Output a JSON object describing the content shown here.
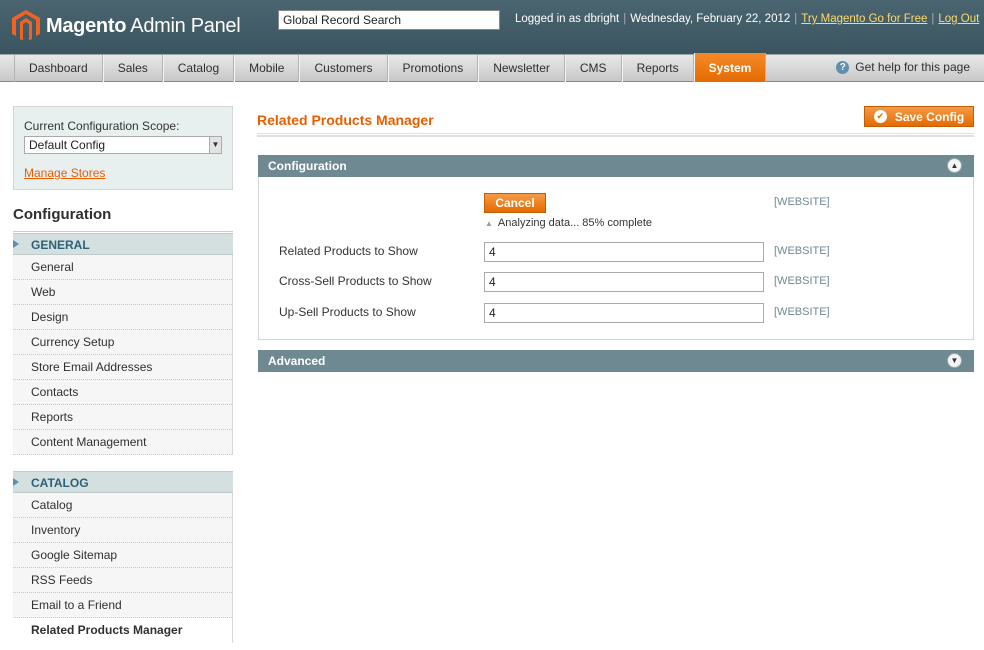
{
  "header": {
    "logo_brand": "Magento",
    "logo_suffix": "Admin Panel",
    "search_value": "Global Record Search",
    "logged_in": "Logged in as dbright",
    "date": "Wednesday, February 22, 2012",
    "try_link": "Try Magento Go for Free",
    "logout": "Log Out",
    "brand_color": "#eb5e00"
  },
  "nav": {
    "items": [
      "Dashboard",
      "Sales",
      "Catalog",
      "Mobile",
      "Customers",
      "Promotions",
      "Newsletter",
      "CMS",
      "Reports",
      "System"
    ],
    "active": "System",
    "help": "Get help for this page"
  },
  "sidebar": {
    "scope_label": "Current Configuration Scope:",
    "scope_value": "Default Config",
    "manage_stores": "Manage Stores",
    "title": "Configuration",
    "groups": [
      {
        "label": "GENERAL",
        "items": [
          "General",
          "Web",
          "Design",
          "Currency Setup",
          "Store Email Addresses",
          "Contacts",
          "Reports",
          "Content Management"
        ]
      },
      {
        "label": "CATALOG",
        "items": [
          "Catalog",
          "Inventory",
          "Google Sitemap",
          "RSS Feeds",
          "Email to a Friend",
          "Related Products Manager"
        ]
      }
    ],
    "active_item": "Related Products Manager"
  },
  "main": {
    "title": "Related Products Manager",
    "save_label": "Save Config",
    "configuration": {
      "header": "Configuration",
      "cancel_label": "Cancel",
      "progress_text": "Analyzing data... 85% complete",
      "progress_percent": 85,
      "cancel_scope": "[WEBSITE]",
      "fields": [
        {
          "label": "Related Products to Show",
          "value": "4",
          "scope": "[WEBSITE]"
        },
        {
          "label": "Cross-Sell Products to Show",
          "value": "4",
          "scope": "[WEBSITE]"
        },
        {
          "label": "Up-Sell Products to Show",
          "value": "4",
          "scope": "[WEBSITE]"
        }
      ]
    },
    "advanced": {
      "header": "Advanced"
    }
  }
}
